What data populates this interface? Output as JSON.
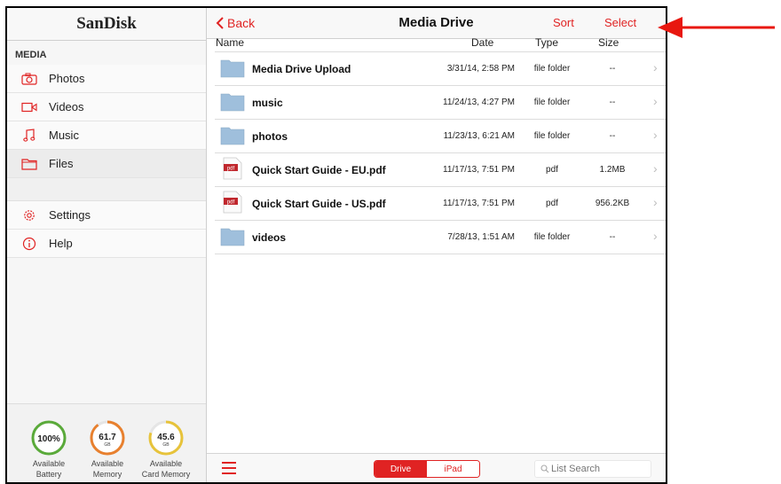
{
  "colors": {
    "accent": "#e02323",
    "folder": "#9fbfdc",
    "gauge_green": "#5aaa3a",
    "gauge_yellow": "#e7c33a",
    "gauge_orange": "#e8802e"
  },
  "sidebar": {
    "brand": "SanDisk",
    "section": "MEDIA",
    "items": [
      {
        "label": "Photos",
        "icon": "camera-icon"
      },
      {
        "label": "Videos",
        "icon": "video-camera-icon"
      },
      {
        "label": "Music",
        "icon": "music-note-icon"
      },
      {
        "label": "Files",
        "icon": "folder-icon"
      }
    ],
    "extra_items": [
      {
        "label": "Settings",
        "icon": "gear-icon"
      },
      {
        "label": "Help",
        "icon": "info-icon"
      }
    ],
    "gauges": [
      {
        "value": "100%",
        "unit": "",
        "caption1": "Available",
        "caption2": "Battery",
        "fill": 1.0
      },
      {
        "value": "61.7",
        "unit": "GB",
        "caption1": "Available",
        "caption2": "Memory",
        "fill": 0.9
      },
      {
        "value": "45.6",
        "unit": "GB",
        "caption1": "Available",
        "caption2": "Card Memory",
        "fill": 0.8
      }
    ]
  },
  "header": {
    "back": "Back",
    "title": "Media Drive",
    "sort": "Sort",
    "select": "Select"
  },
  "columns": {
    "name": "Name",
    "date": "Date",
    "type": "Type",
    "size": "Size"
  },
  "files": [
    {
      "name": "Media Drive Upload",
      "date": "3/31/14, 2:58 PM",
      "type": "file folder",
      "size": "--",
      "kind": "folder"
    },
    {
      "name": "music",
      "date": "11/24/13, 4:27 PM",
      "type": "file folder",
      "size": "--",
      "kind": "folder"
    },
    {
      "name": "photos",
      "date": "11/23/13, 6:21 AM",
      "type": "file folder",
      "size": "--",
      "kind": "folder"
    },
    {
      "name": "Quick Start Guide - EU.pdf",
      "date": "11/17/13, 7:51 PM",
      "type": "pdf",
      "size": "1.2MB",
      "kind": "pdf"
    },
    {
      "name": "Quick Start Guide - US.pdf",
      "date": "11/17/13, 7:51 PM",
      "type": "pdf",
      "size": "956.2KB",
      "kind": "pdf"
    },
    {
      "name": "videos",
      "date": "7/28/13, 1:51 AM",
      "type": "file folder",
      "size": "--",
      "kind": "folder"
    }
  ],
  "pdf_badge": "pdf",
  "bottom": {
    "seg_drive": "Drive",
    "seg_ipad": "iPad",
    "search_placeholder": "List Search"
  }
}
